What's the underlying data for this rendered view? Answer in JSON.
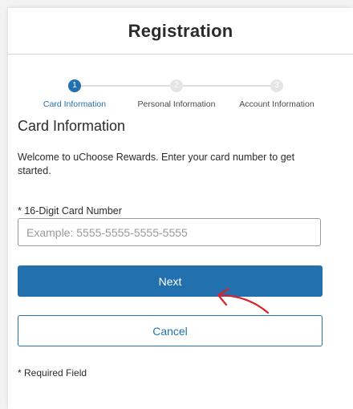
{
  "header": {
    "title": "Registration"
  },
  "stepper": {
    "steps": [
      {
        "number": "1",
        "label": "Card Information",
        "state": "active"
      },
      {
        "number": "2",
        "label": "Personal Information",
        "state": "inactive"
      },
      {
        "number": "3",
        "label": "Account Information",
        "state": "inactive"
      }
    ],
    "active_color": "#2271ae",
    "inactive_color": "#e5e5e5"
  },
  "form": {
    "section_title": "Card Information",
    "welcome_text": "Welcome to uChoose Rewards. Enter your card number to get started.",
    "card_number_label": "* 16-Digit Card Number",
    "card_number_value": "",
    "card_number_placeholder": "Example: 5555-5555-5555-5555",
    "next_label": "Next",
    "cancel_label": "Cancel",
    "required_note": "* Required Field"
  },
  "colors": {
    "primary": "#2271ae",
    "text": "#2b2b2b",
    "annotation": "#d9232d"
  }
}
